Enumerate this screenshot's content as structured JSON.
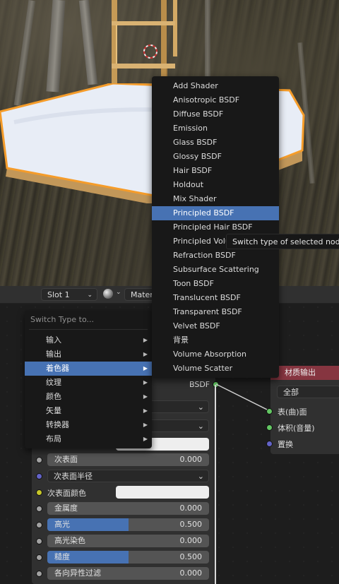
{
  "editor_header": {
    "slot_label": "Slot 1",
    "material_label": "Materi"
  },
  "shader_menu": {
    "items": [
      "Add Shader",
      "Anisotropic BSDF",
      "Diffuse BSDF",
      "Emission",
      "Glass BSDF",
      "Glossy BSDF",
      "Hair BSDF",
      "Holdout",
      "Mix Shader",
      "Principled BSDF",
      "Principled Hair BSDF",
      "Principled Volu",
      "Refraction BSDF",
      "Subsurface Scattering",
      "Toon BSDF",
      "Translucent BSDF",
      "Transparent BSDF",
      "Velvet BSDF",
      "背景",
      "Volume Absorption",
      "Volume Scatter"
    ],
    "highlighted": "Principled BSDF"
  },
  "tooltip": "Switch type of selected nodes",
  "switch_type_menu": {
    "title": "Switch Type to...",
    "items": [
      "输入",
      "输出",
      "着色器",
      "纹理",
      "颜色",
      "矢量",
      "转换器",
      "布局"
    ],
    "highlighted": "着色器"
  },
  "principled_node": {
    "output_label": "BSDF",
    "rows": [
      {
        "label": "次表面",
        "value": "0.000",
        "fill": 0
      },
      {
        "label": "金属度",
        "value": "0.000",
        "fill": 0
      },
      {
        "label": "高光",
        "value": "0.500",
        "fill": 0.5
      },
      {
        "label": "高光染色",
        "value": "0.000",
        "fill": 0
      },
      {
        "label": "糙度",
        "value": "0.500",
        "fill": 0.5
      },
      {
        "label": "各向异性过滤",
        "value": "0.000",
        "fill": 0
      }
    ],
    "subsurface_method": "次表面半径",
    "subsurface_color_label": "次表面颜色"
  },
  "material_output": {
    "title": "材质输出",
    "target": "全部",
    "inputs": [
      "表(曲)面",
      "体积(音量)",
      "置换"
    ]
  },
  "colors": {
    "accent": "#4772b3",
    "output_header": "#863540",
    "socket_green": "#63c763",
    "socket_purple": "#6363c7",
    "socket_yellow": "#c7c729",
    "socket_gray": "#a1a1a1"
  }
}
